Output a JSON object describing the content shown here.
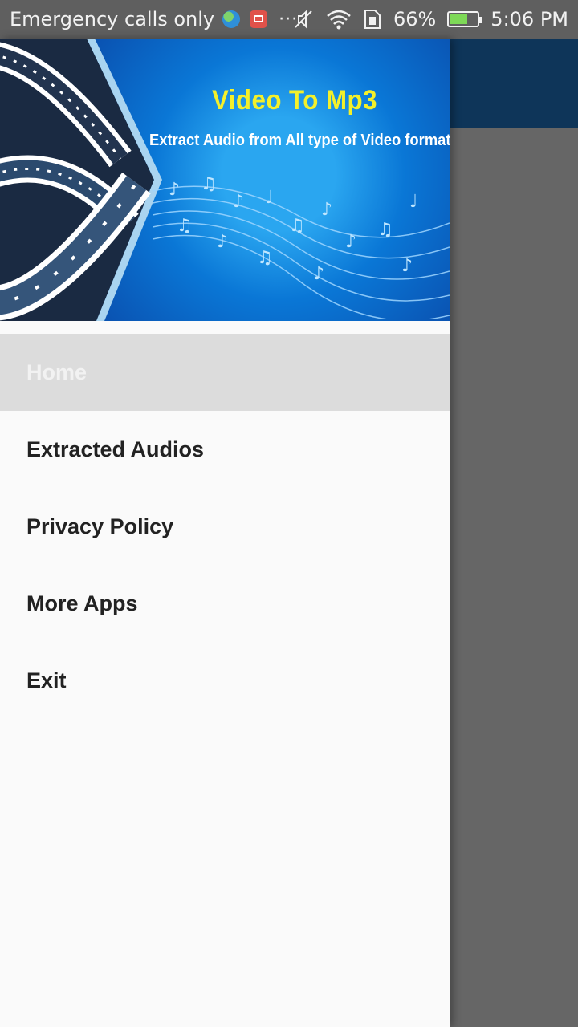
{
  "status_bar": {
    "carrier_text": "Emergency calls only",
    "overflow": "···",
    "battery_percent": "66%",
    "battery_level": 0.66,
    "time": "5:06 PM",
    "icons": [
      "globe-icon",
      "mailbox-icon",
      "mute-icon",
      "wifi-icon",
      "sim-icon",
      "battery-icon"
    ]
  },
  "drawer": {
    "header": {
      "title": "Video To Mp3",
      "subtitle": "Extract Audio from All type of Video formats"
    },
    "items": [
      {
        "label": "Home",
        "active": true
      },
      {
        "label": "Extracted Audios",
        "active": false
      },
      {
        "label": "Privacy Policy",
        "active": false
      },
      {
        "label": "More Apps",
        "active": false
      },
      {
        "label": "Exit",
        "active": false
      }
    ]
  },
  "colors": {
    "status_bar": "#5f5f5f",
    "app_toolbar": "#0e3559",
    "scrim": "#666666",
    "drawer_bg": "#fafafa",
    "active_item_bg": "#dcdcdc",
    "banner_title": "#f4f02a",
    "banner_blue": "#0a77d6"
  }
}
